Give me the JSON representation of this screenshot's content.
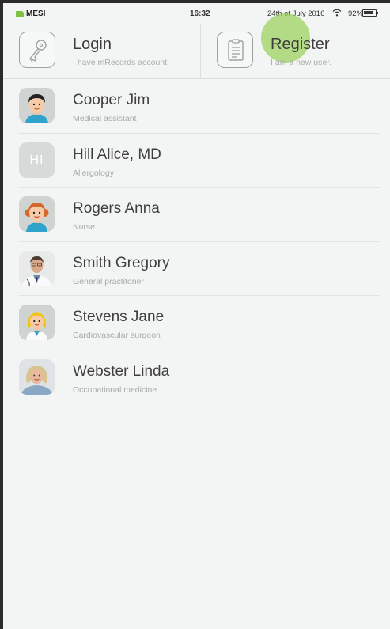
{
  "status_bar": {
    "carrier": "MESI",
    "time": "16:32",
    "date": "24th of July 2016",
    "battery": "92%",
    "battery_level": 0.92,
    "icons": [
      "wifi-icon",
      "battery-icon"
    ]
  },
  "actions": {
    "login": {
      "title": "Login",
      "subtitle": "I have mRecords account.",
      "icon": "key-icon"
    },
    "register": {
      "title": "Register",
      "subtitle": "I am a new user.",
      "icon": "clipboard-icon"
    }
  },
  "users": [
    {
      "name": "Cooper Jim",
      "role": "Medical assistant",
      "avatar": "male-cartoon-avatar"
    },
    {
      "name": "Hill Alice, MD",
      "role": "Allergology",
      "avatar_initials": "HI"
    },
    {
      "name": "Rogers Anna",
      "role": "Nurse",
      "avatar": "female-cartoon-avatar"
    },
    {
      "name": "Smith Gregory",
      "role": "General practitoner",
      "avatar": "doctor-photo"
    },
    {
      "name": "Stevens Jane",
      "role": "Cardiovascular surgeon",
      "avatar": "female-doctor-cartoon-avatar"
    },
    {
      "name": "Webster Linda",
      "role": "Occupational medicine",
      "avatar": "woman-photo"
    }
  ],
  "colors": {
    "accent_green": "#7fc142",
    "ripple": "#9ed05f",
    "background": "#f3f5f4"
  }
}
